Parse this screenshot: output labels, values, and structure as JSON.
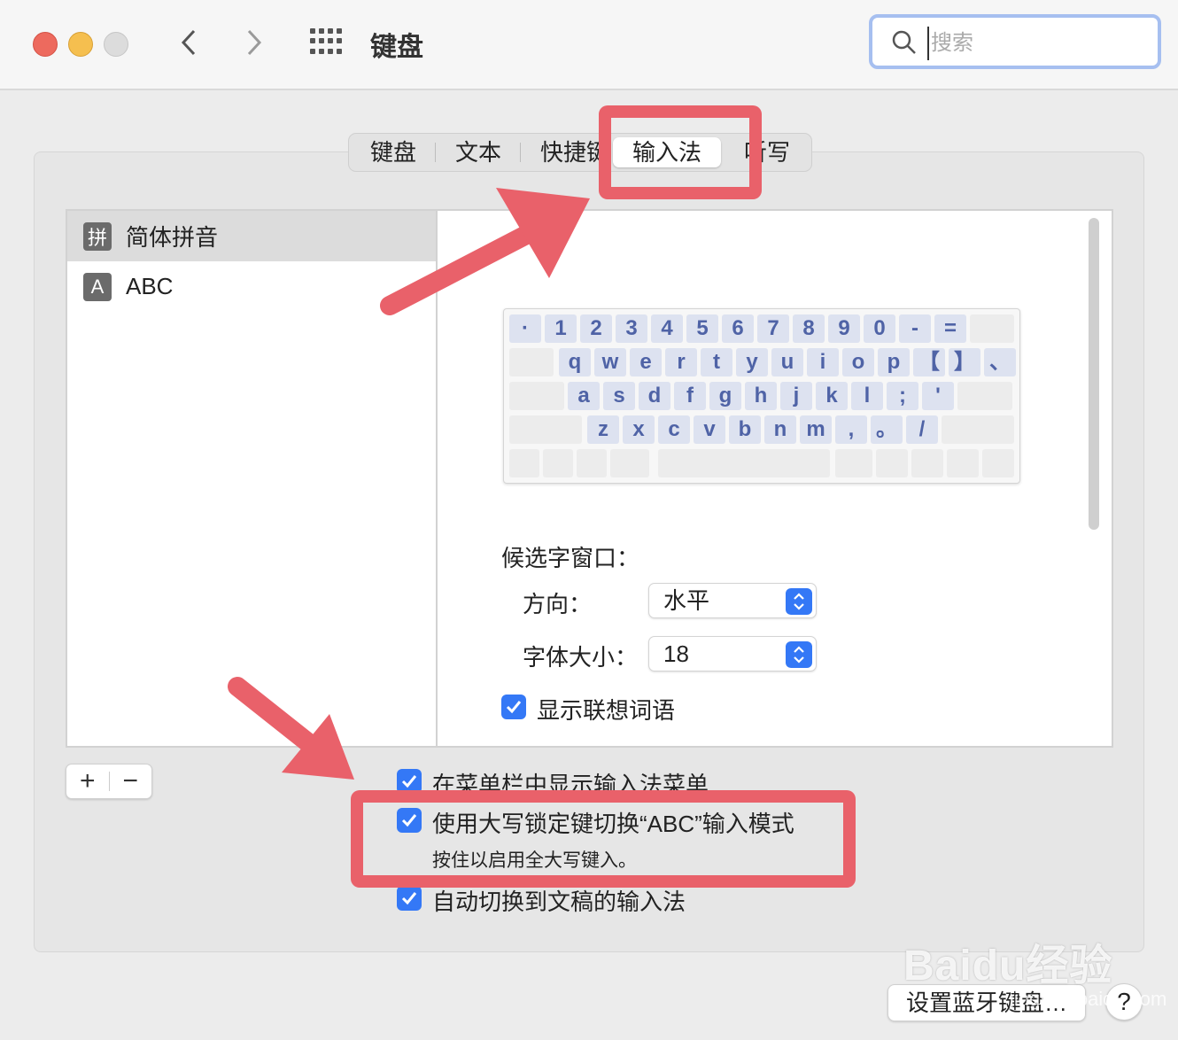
{
  "window": {
    "title": "键盘",
    "search_placeholder": "搜索"
  },
  "tabs": [
    {
      "label": "键盘",
      "active": false
    },
    {
      "label": "文本",
      "active": false
    },
    {
      "label": "快捷键",
      "active": false
    },
    {
      "label": "输入法",
      "active": true
    },
    {
      "label": "听写",
      "active": false
    }
  ],
  "input_sources": [
    {
      "badge": "拼",
      "label": "简体拼音",
      "selected": true
    },
    {
      "badge": "A",
      "label": "ABC",
      "selected": false
    }
  ],
  "keyboard": {
    "row1": [
      "·",
      "1",
      "2",
      "3",
      "4",
      "5",
      "6",
      "7",
      "8",
      "9",
      "0",
      "-",
      "="
    ],
    "row2": [
      "q",
      "w",
      "e",
      "r",
      "t",
      "y",
      "u",
      "i",
      "o",
      "p",
      "【",
      "】",
      "、"
    ],
    "row3": [
      "a",
      "s",
      "d",
      "f",
      "g",
      "h",
      "j",
      "k",
      "l",
      ";",
      "'"
    ],
    "row4": [
      "z",
      "x",
      "c",
      "v",
      "b",
      "n",
      "m",
      ",",
      "。",
      "/"
    ]
  },
  "candidate": {
    "section_label": "候选字窗口：",
    "direction_label": "方向：",
    "direction_value": "水平",
    "font_size_label": "字体大小：",
    "font_size_value": "18",
    "show_predictions_label": "显示联想词语"
  },
  "options": {
    "show_menu_label": "在菜单栏中显示输入法菜单",
    "caps_lock_label": "使用大写锁定键切换“ABC”输入模式",
    "caps_lock_hint": "按住以启用全大写键入。",
    "auto_switch_label": "自动切换到文稿的输入法"
  },
  "controls": {
    "add_symbol": "+",
    "remove_symbol": "−",
    "bluetooth_button": "设置蓝牙键盘…",
    "help_symbol": "?"
  },
  "watermark": {
    "brand": "Baidu经验",
    "sub": "jingyan.baidu.com"
  },
  "colors": {
    "accent": "#3478f6",
    "annotation": "#e9616a",
    "key_text": "#4f63a6"
  }
}
